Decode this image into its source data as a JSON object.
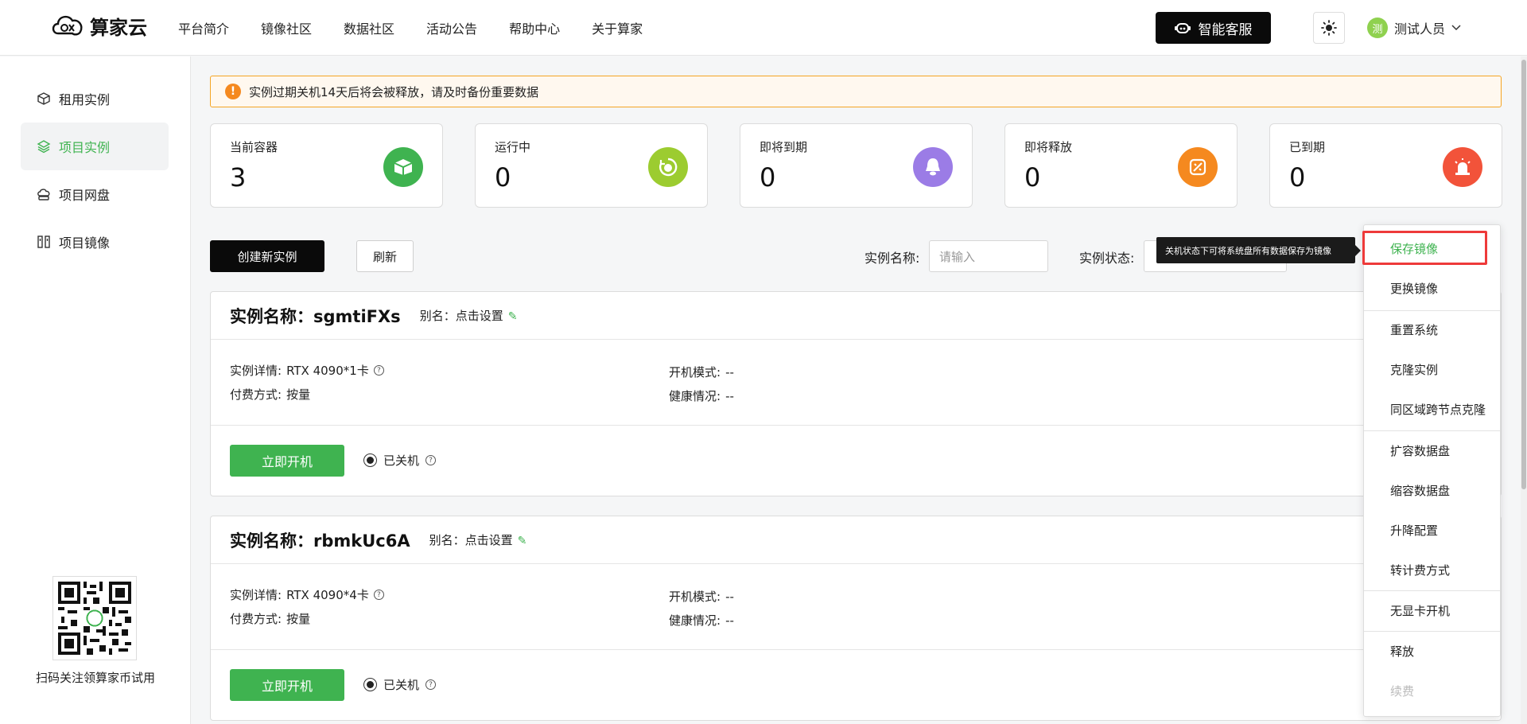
{
  "header": {
    "brand": "算家云",
    "nav": [
      "平台简介",
      "镜像社区",
      "数据社区",
      "活动公告",
      "帮助中心",
      "关于算家"
    ],
    "ai_service": "智能客服",
    "user_avatar": "测",
    "user_name": "测试人员"
  },
  "sidebar": {
    "items": [
      {
        "label": "租用实例",
        "icon": "cube-icon"
      },
      {
        "label": "项目实例",
        "icon": "layers-icon"
      },
      {
        "label": "项目网盘",
        "icon": "cloud-disk-icon"
      },
      {
        "label": "项目镜像",
        "icon": "mirror-icon"
      }
    ],
    "active_index": 1,
    "qr_caption": "扫码关注领算家币试用"
  },
  "notice": "实例过期关机14天后将会被释放，请及时备份重要数据",
  "stats": [
    {
      "label": "当前容器",
      "value": "3",
      "color": "#3fb350",
      "icon": "container-icon"
    },
    {
      "label": "运行中",
      "value": "0",
      "color": "#9ccc30",
      "icon": "running-icon"
    },
    {
      "label": "即将到期",
      "value": "0",
      "color": "#9b7ce6",
      "icon": "bell-icon"
    },
    {
      "label": "即将释放",
      "value": "0",
      "color": "#f5891f",
      "icon": "release-icon"
    },
    {
      "label": "已到期",
      "value": "0",
      "color": "#f2533a",
      "icon": "alarm-icon"
    }
  ],
  "toolbar": {
    "create": "创建新实例",
    "refresh": "刷新",
    "name_label": "实例名称:",
    "name_placeholder": "请输入",
    "status_label": "实例状态:"
  },
  "instances": [
    {
      "title": "实例名称：sgmtiFXs",
      "alias_label": "别名：点击设置",
      "detail_label": "实例详情:",
      "detail_value": "RTX 4090*1卡",
      "pay_label": "付费方式:",
      "pay_value": "按量",
      "boot_label": "开机模式:",
      "boot_value": "--",
      "health_label": "健康情况:",
      "health_value": "--",
      "start": "立即开机",
      "status": "已关机"
    },
    {
      "title": "实例名称：rbmkUc6A",
      "alias_label": "别名：点击设置",
      "detail_label": "实例详情:",
      "detail_value": "RTX 4090*4卡",
      "pay_label": "付费方式:",
      "pay_value": "按量",
      "boot_label": "开机模式:",
      "boot_value": "--",
      "health_label": "健康情况:",
      "health_value": "--",
      "start": "立即开机",
      "status": "已关机"
    }
  ],
  "dropdown": {
    "tooltip": "关机状态下可将系统盘所有数据保存为镜像",
    "items": [
      "保存镜像",
      "更换镜像",
      "重置系统",
      "克隆实例",
      "同区域跨节点克隆",
      "扩容数据盘",
      "缩容数据盘",
      "升降配置",
      "转计费方式",
      "无显卡开机",
      "释放",
      "续费"
    ]
  }
}
